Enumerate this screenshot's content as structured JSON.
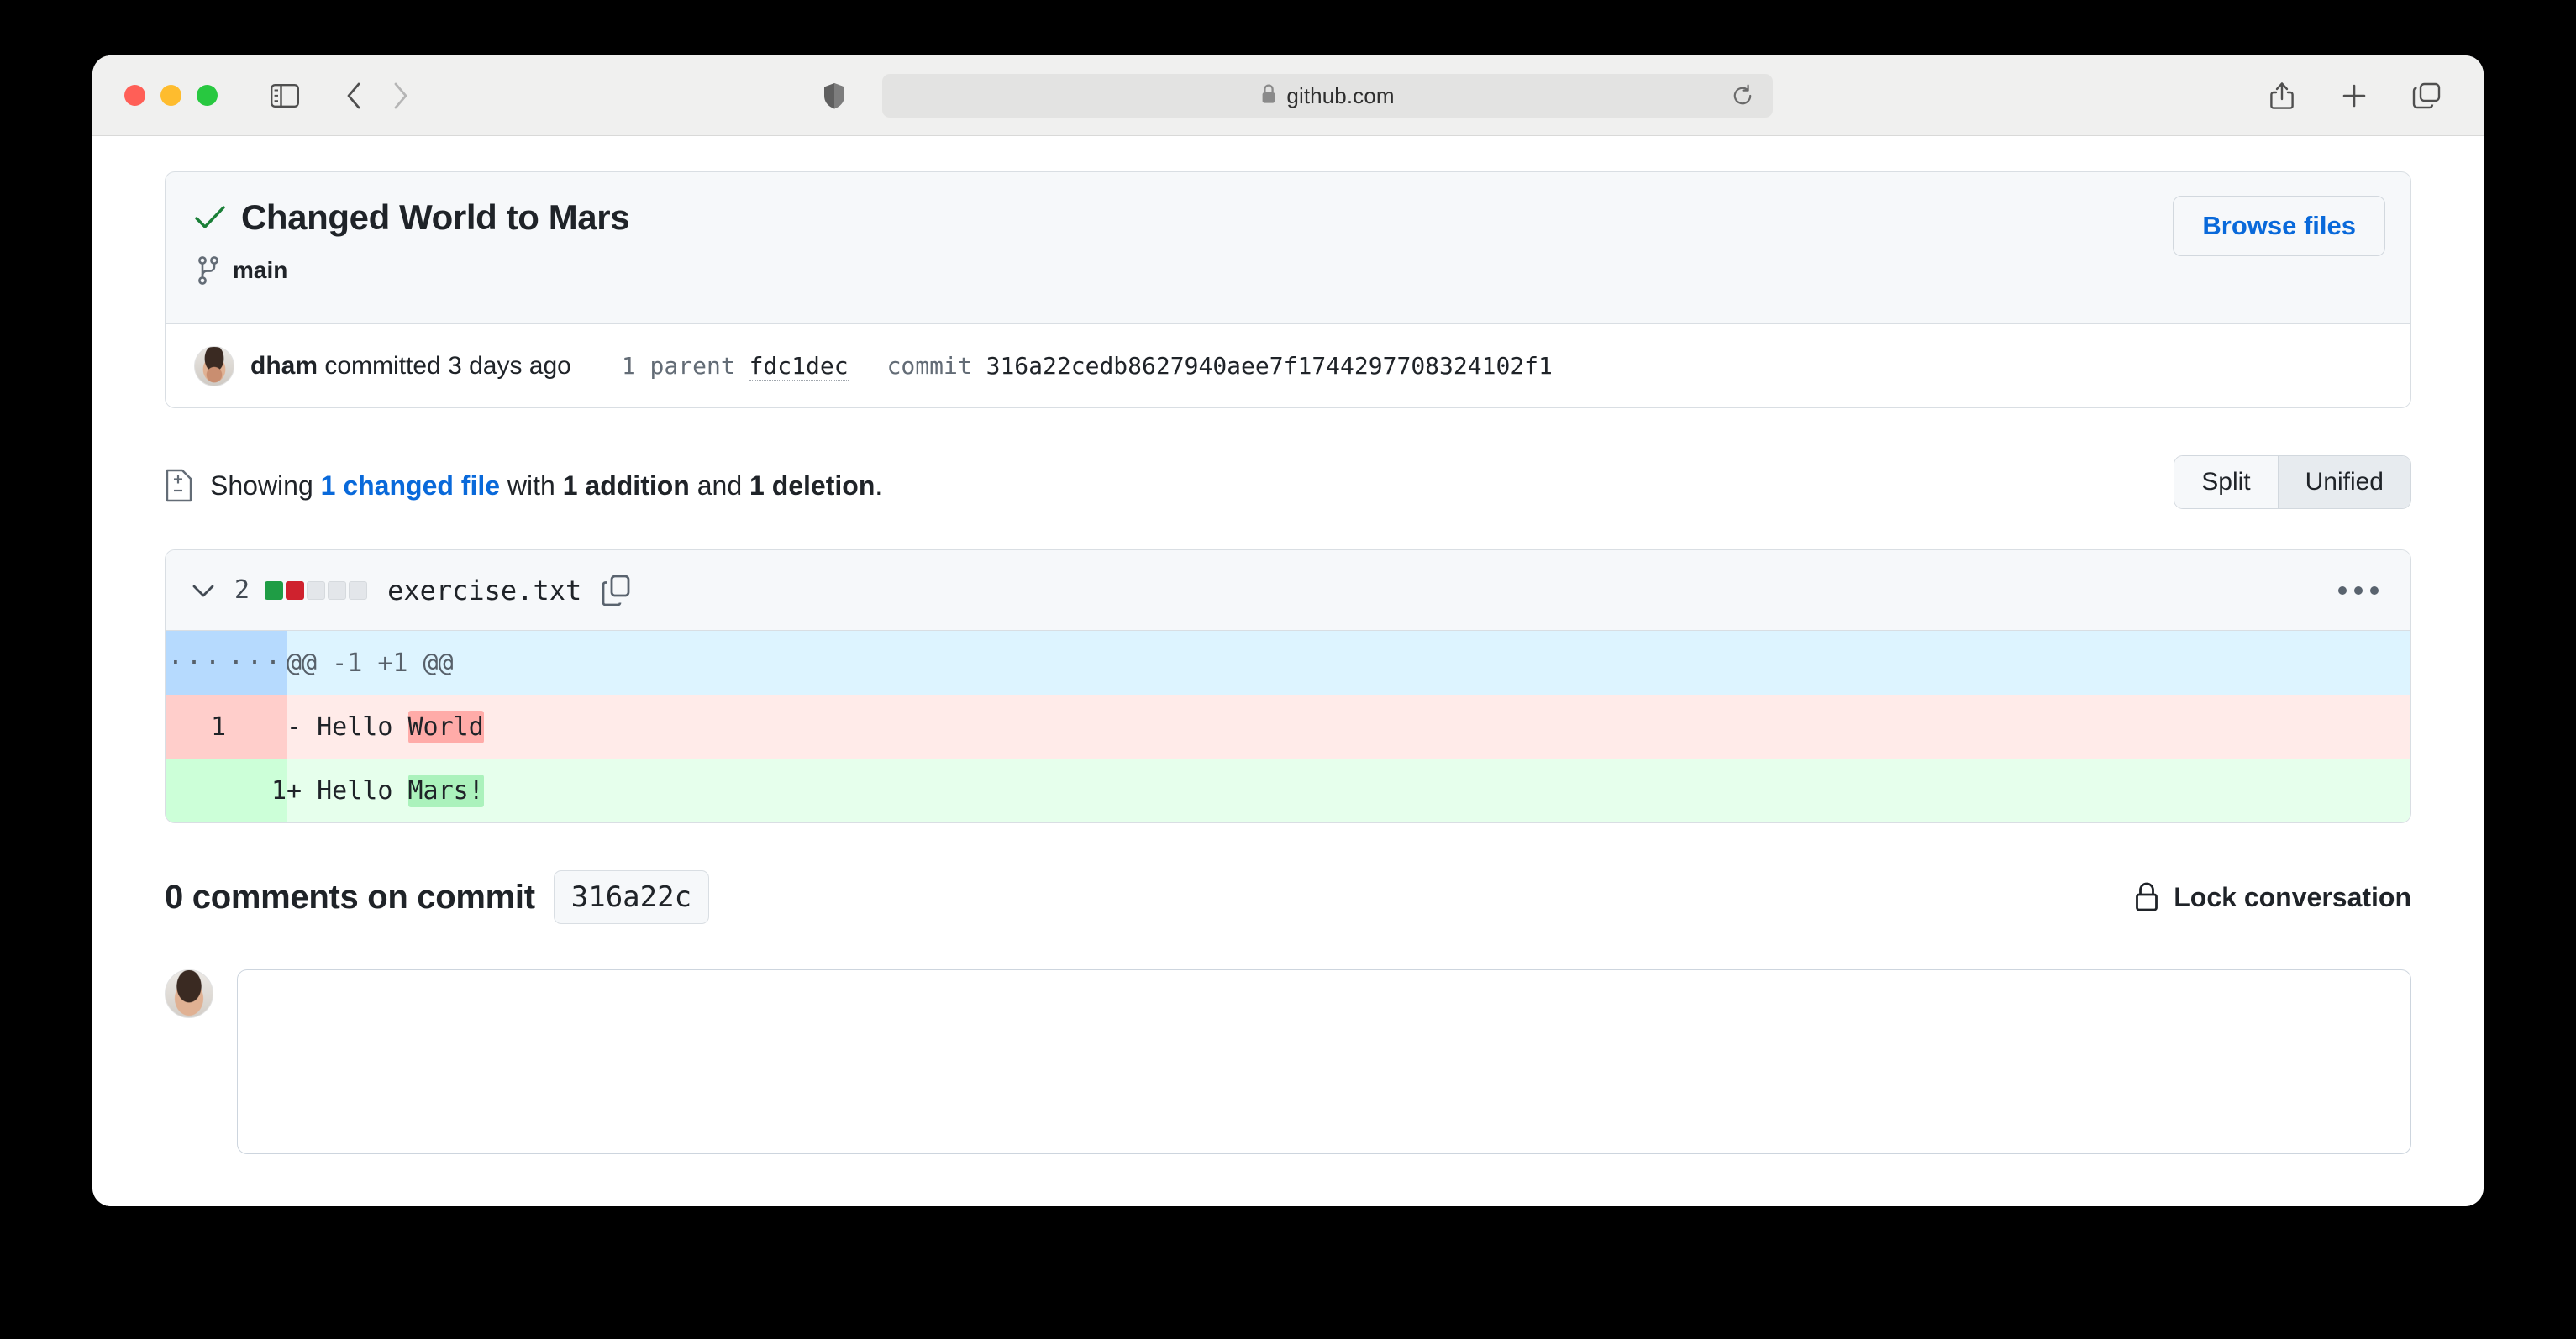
{
  "browser": {
    "url": "github.com",
    "traffic_lights": [
      "close",
      "minimize",
      "zoom"
    ],
    "icons": {
      "sidebar": "sidebar-icon",
      "back": "back-chevron-icon",
      "forward": "forward-chevron-icon",
      "shield": "privacy-shield-icon",
      "lock": "lock-icon",
      "reload": "reload-icon",
      "share": "share-icon",
      "new_tab": "plus-icon",
      "tab_overview": "tab-overview-icon"
    }
  },
  "commit": {
    "title": "Changed World to Mars",
    "status_icon": "check-icon",
    "branch_icon": "git-branch-icon",
    "branch": "main",
    "browse_files_label": "Browse files",
    "author": "dham",
    "author_action": "committed 3 days ago",
    "parent_label": "1 parent",
    "parent_hash": "fdc1dec",
    "commit_label": "commit",
    "commit_hash": "316a22cedb8627940aee7f1744297708324102f1"
  },
  "summary": {
    "file_icon": "diff-file-icon",
    "prefix": "Showing ",
    "changed_files": "1 changed file",
    "middle": " with ",
    "additions": "1 addition",
    "conjunction": " and ",
    "deletions": "1 deletion",
    "suffix": ".",
    "view_modes": [
      {
        "label": "Split",
        "active": false
      },
      {
        "label": "Unified",
        "active": true
      }
    ]
  },
  "diff": {
    "chevron_icon": "chevron-down-icon",
    "changes_count": "2",
    "diffstat": [
      "add",
      "del",
      "neutral",
      "neutral",
      "neutral"
    ],
    "filename": "exercise.txt",
    "copy_icon": "copy-icon",
    "menu_icon": "kebab-menu-icon",
    "rows": [
      {
        "type": "hunk",
        "old_num": "···",
        "new_num": "···",
        "code": "@@ -1 +1 @@"
      },
      {
        "type": "del",
        "old_num": "1",
        "new_num": "",
        "prefix": "- Hello ",
        "highlight": "World",
        "rest": ""
      },
      {
        "type": "add",
        "old_num": "",
        "new_num": "1",
        "prefix": "+ Hello ",
        "highlight": "Mars!",
        "rest": ""
      }
    ]
  },
  "comments": {
    "title": "0 comments on commit",
    "short_hash": "316a22c",
    "lock_icon": "lock-closed-icon",
    "lock_label": "Lock conversation"
  }
}
